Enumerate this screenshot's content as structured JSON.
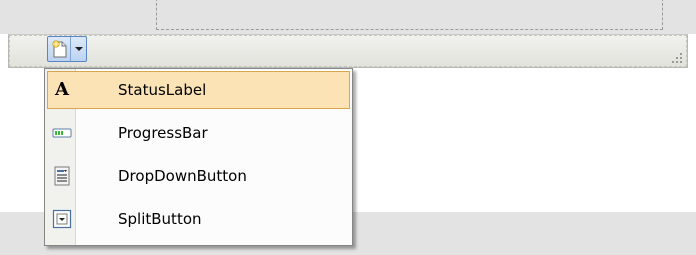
{
  "menu": {
    "items": [
      {
        "label": "StatusLabel",
        "icon": "letter-a-icon",
        "selected": true
      },
      {
        "label": "ProgressBar",
        "icon": "progress-bar-icon",
        "selected": false
      },
      {
        "label": "DropDownButton",
        "icon": "dropdown-button-icon",
        "selected": false
      },
      {
        "label": "SplitButton",
        "icon": "split-button-icon",
        "selected": false
      }
    ]
  },
  "colors": {
    "designer_background": "#e3e3e3",
    "menu_highlight": "#fbe3b6",
    "menu_highlight_border": "#d8a64e",
    "menu_border": "#868686",
    "button_border": "#5a86c4"
  }
}
